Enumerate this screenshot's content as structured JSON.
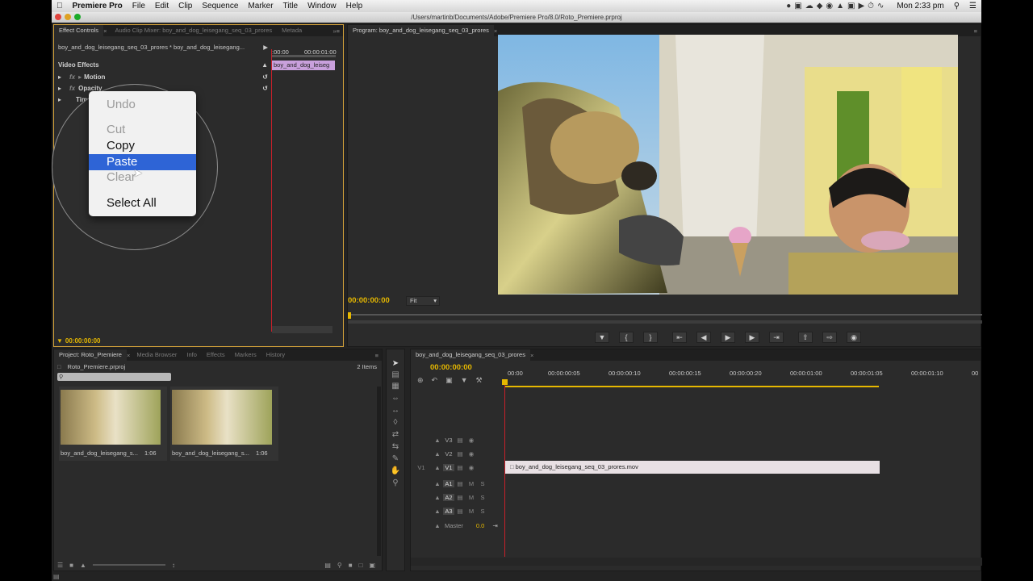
{
  "menubar": {
    "app": "Premiere Pro",
    "items": [
      "File",
      "Edit",
      "Clip",
      "Sequence",
      "Marker",
      "Title",
      "Window",
      "Help"
    ],
    "clock": "Mon 2:33 pm"
  },
  "window": {
    "path": "/Users/martinb/Documents/Adobe/Premiere Pro/8.0/Roto_Premiere.prproj"
  },
  "effect_controls": {
    "tabs": [
      "Effect Controls",
      "Audio Clip Mixer: boy_and_dog_leisegang_seq_03_prores",
      "Metada"
    ],
    "source_label": "boy_and_dog_leisegang_seq_03_prores * boy_and_dog_leisegang...",
    "ruler_start": ":00:00",
    "ruler_end": "00:00:01:00",
    "clip_label": "boy_and_dog_leiseg",
    "section": "Video Effects",
    "effects": [
      "Motion",
      "Opacity",
      "Tim"
    ],
    "timecode": "00:00:00:00"
  },
  "context_menu": {
    "items": [
      {
        "label": "Undo",
        "enabled": false
      },
      {
        "label": "Cut",
        "enabled": false
      },
      {
        "label": "Copy",
        "enabled": true
      },
      {
        "label": "Paste",
        "enabled": true,
        "highlighted": true
      },
      {
        "label": "Clear",
        "enabled": false
      },
      {
        "label": "Select All",
        "enabled": true
      }
    ]
  },
  "program": {
    "tab": "Program: boy_and_dog_leisegang_seq_03_prores",
    "timecode": "00:00:00:00",
    "zoom": "Fit"
  },
  "project": {
    "tabs": [
      "Project: Roto_Premiere",
      "Media Browser",
      "Info",
      "Effects",
      "Markers",
      "History"
    ],
    "filename": "Roto_Premiere.prproj",
    "item_count": "2 Items",
    "items": [
      {
        "name": "boy_and_dog_leisegang_s...",
        "duration": "1:06"
      },
      {
        "name": "boy_and_dog_leisegang_s...",
        "duration": "1:06"
      }
    ]
  },
  "timeline": {
    "tab": "boy_and_dog_leisegang_seq_03_prores",
    "timecode": "00:00:00:00",
    "ruler": [
      "00:00",
      "00:00:00:05",
      "00:00:00:10",
      "00:00:00:15",
      "00:00:00:20",
      "00:00:01:00",
      "00:00:01:05",
      "00:00:01:10",
      "00"
    ],
    "video_tracks": [
      "V3",
      "V2",
      "V1"
    ],
    "source_patch": "V1",
    "audio_tracks": [
      "A1",
      "A2",
      "A3"
    ],
    "track_m": "M",
    "track_s": "S",
    "master_label": "Master",
    "master_value": "0.0",
    "clip_name": "boy_and_dog_leisegang_seq_03_prores.mov"
  },
  "colors": {
    "accent": "#e6b800",
    "highlight": "#2e64d6",
    "clip": "#e8e0e4",
    "playhead": "#c8202a"
  }
}
